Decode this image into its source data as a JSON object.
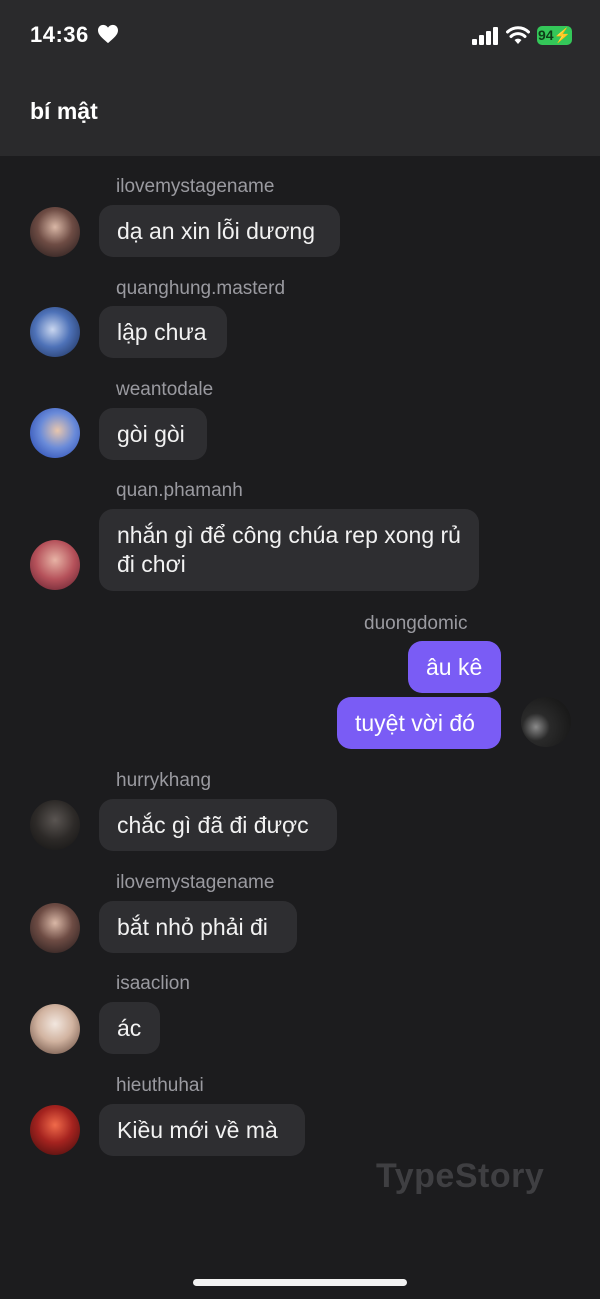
{
  "status": {
    "time": "14:36",
    "battery": "94"
  },
  "header": {
    "title": "bí mật"
  },
  "messages": [
    {
      "user": "ilovemystagename",
      "text": "dạ an xin lỗi dương"
    },
    {
      "user": "quanghung.masterd",
      "text": "lập chưa"
    },
    {
      "user": "weantodale",
      "text": "gòi gòi"
    },
    {
      "user": "quan.phamanh",
      "text": "nhắn gì để công chúa rep xong rủ đi chơi"
    },
    {
      "user": "duongdomic",
      "texts": [
        "âu kê",
        "tuyệt vời đó"
      ]
    },
    {
      "user": "hurrykhang",
      "text": "chắc gì đã đi được"
    },
    {
      "user": "ilovemystagename",
      "text": "bắt nhỏ phải đi"
    },
    {
      "user": "isaaclion",
      "text": "ác"
    },
    {
      "user": "hieuthuhai",
      "text": "Kiều mới về mà"
    }
  ],
  "watermark": "TypeStory",
  "colors": {
    "bubble": "#2e2e31",
    "mine_bubble": "#7a5cf5",
    "background": "#1c1c1e"
  }
}
